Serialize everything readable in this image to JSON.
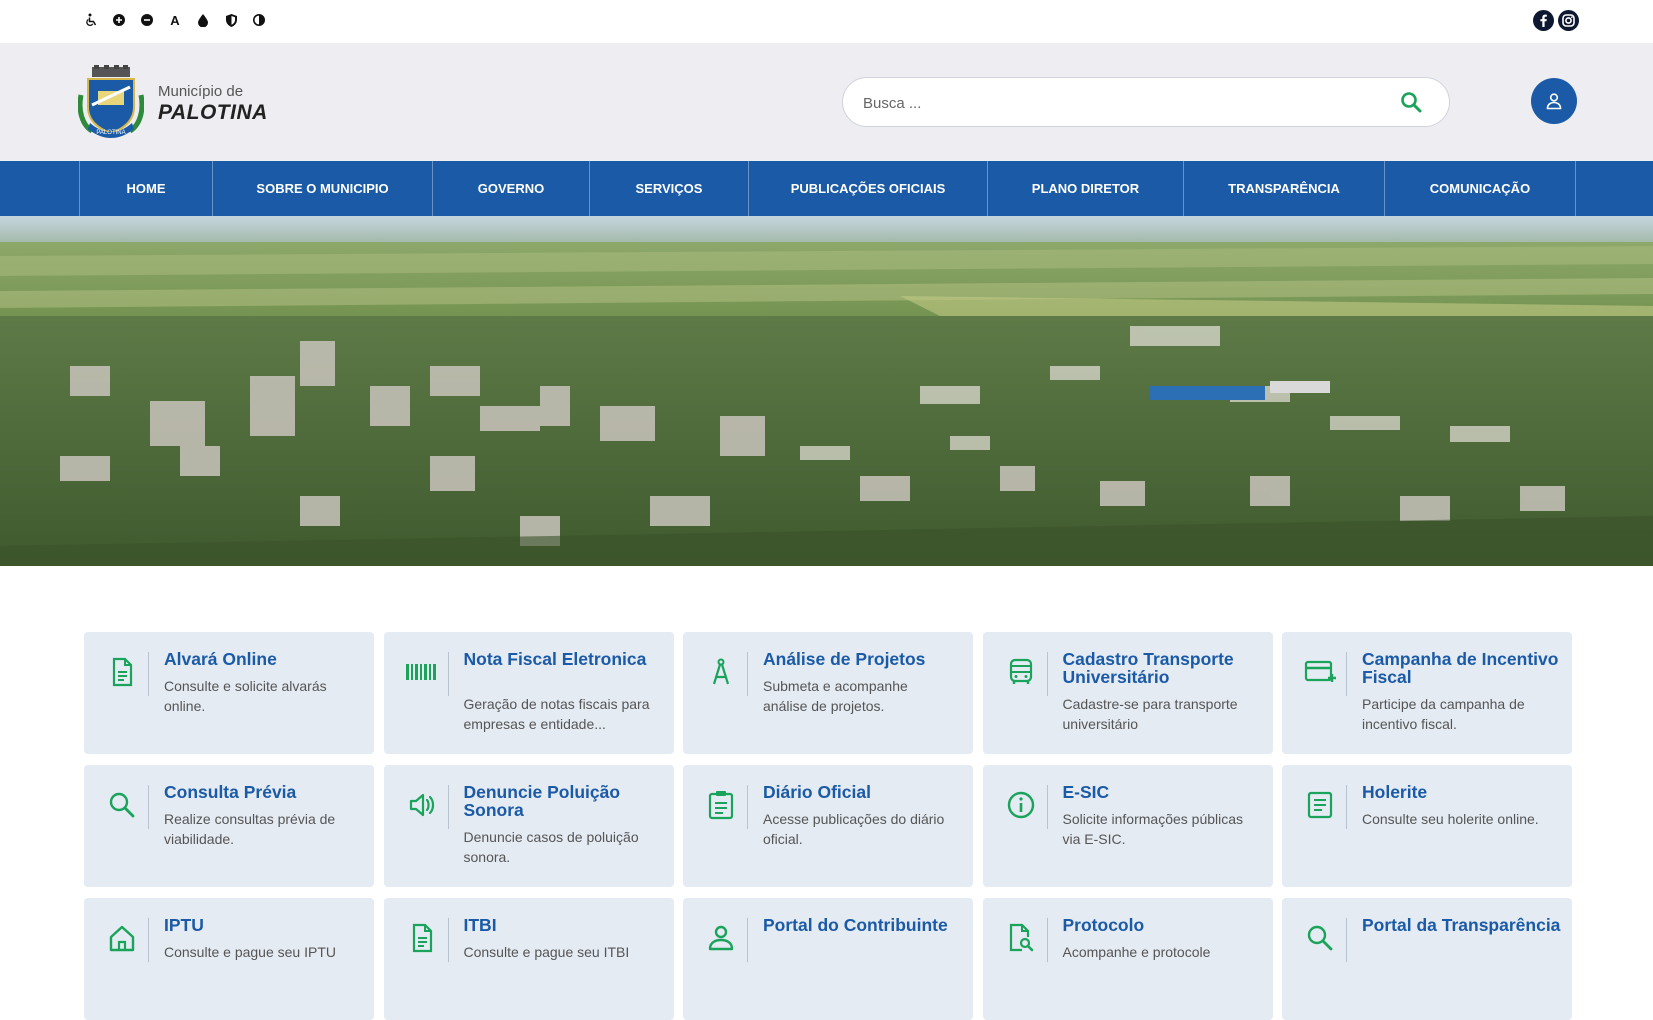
{
  "accessibility": {
    "icons": [
      "wheelchair-icon",
      "zoom-in-icon",
      "zoom-out-icon",
      "font-size-icon",
      "contrast-drop-icon",
      "shield-icon",
      "high-contrast-icon"
    ],
    "font_label": "A"
  },
  "social": {
    "icons": [
      "facebook-icon",
      "instagram-icon"
    ]
  },
  "brand": {
    "line1": "Município de",
    "line2": "PALOTINA",
    "seal_text": "PALOTINA"
  },
  "search": {
    "placeholder": "Busca ..."
  },
  "nav": {
    "items": [
      {
        "label": "HOME"
      },
      {
        "label": "SOBRE O MUNICIPIO"
      },
      {
        "label": "GOVERNO"
      },
      {
        "label": "SERVIÇOS"
      },
      {
        "label": "PUBLICAÇÕES OFICIAIS"
      },
      {
        "label": "PLANO DIRETOR"
      },
      {
        "label": "TRANSPARÊNCIA"
      },
      {
        "label": "COMUNICAÇÃO"
      }
    ]
  },
  "colors": {
    "primary": "#1b5aa6",
    "icon_green": "#1aa35a",
    "card_bg": "#e4ebf3"
  },
  "cards": [
    {
      "title": "Alvará Online",
      "desc": "Consulte e solicite alvarás online.",
      "icon": "document-icon"
    },
    {
      "title": "Nota Fiscal Eletronica",
      "desc": "Geração de notas fiscais para empresas e entidade...",
      "icon": "barcode-icon"
    },
    {
      "title": "Análise de Projetos",
      "desc": "Submeta e acompanhe análise de projetos.",
      "icon": "compass-icon"
    },
    {
      "title": "Cadastro Transporte Universitário",
      "desc": "Cadastre-se para transporte universitário",
      "icon": "bus-icon"
    },
    {
      "title": "Campanha de Incentivo Fiscal",
      "desc": "Participe da campanha de incentivo fiscal.",
      "icon": "card-plus-icon"
    },
    {
      "title": "Consulta Prévia",
      "desc": "Realize consultas prévia de viabilidade.",
      "icon": "search-icon"
    },
    {
      "title": "Denuncie Poluição Sonora",
      "desc": "Denuncie casos de poluição sonora.",
      "icon": "speaker-icon"
    },
    {
      "title": "Diário Oficial",
      "desc": "Acesse publicações do diário oficial.",
      "icon": "clipboard-icon"
    },
    {
      "title": "E-SIC",
      "desc": "Solicite informações públicas via E-SIC.",
      "icon": "info-icon"
    },
    {
      "title": "Holerite",
      "desc": "Consulte seu holerite online.",
      "icon": "list-doc-icon"
    },
    {
      "title": "IPTU",
      "desc": "Consulte e pague seu IPTU",
      "icon": "home-icon"
    },
    {
      "title": "ITBI",
      "desc": "Consulte e pague seu ITBI",
      "icon": "document-icon"
    },
    {
      "title": "Portal do Contribuinte",
      "desc": "",
      "icon": "person-icon"
    },
    {
      "title": "Protocolo",
      "desc": "Acompanhe e protocole",
      "icon": "file-search-icon"
    },
    {
      "title": "Portal da Transparência",
      "desc": "",
      "icon": "search-icon"
    }
  ]
}
